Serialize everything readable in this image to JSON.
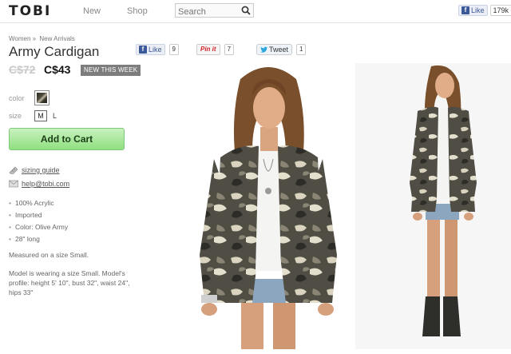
{
  "header": {
    "logo": "TOBI",
    "nav": [
      {
        "label": "New"
      },
      {
        "label": "Shop"
      }
    ],
    "search": {
      "placeholder": "Search",
      "value": ""
    },
    "fb_like": {
      "label": "Like",
      "count": "179k"
    }
  },
  "breadcrumb": {
    "items": [
      "Women",
      "New Arrivals"
    ],
    "separator": "»"
  },
  "product": {
    "title": "Army Cardigan",
    "price_old": "C$72",
    "price_new": "C$43",
    "badge": "NEW THIS WEEK",
    "color_label": "color",
    "size_label": "size",
    "sizes": [
      "M",
      "L"
    ],
    "selected_size": "M",
    "add_to_cart": "Add to Cart",
    "sizing_guide": "sizing guide",
    "help_email": "help@tobi.com",
    "specs": [
      "100% Acrylic",
      "Imported",
      "Color: Olive Army",
      "28\" long"
    ],
    "measured_note": "Measured on a size Small.",
    "model_note": "Model is wearing a size Small. Model's profile: height 5' 10\", bust 32\", waist 24\", hips 33\""
  },
  "share": {
    "fb": {
      "label": "Like",
      "count": "9"
    },
    "pinterest": {
      "label": "Pin it",
      "count": "7"
    },
    "twitter": {
      "label": "Tweet",
      "count": "1"
    }
  },
  "colors": {
    "cart_button": "#8fe07f",
    "facebook": "#3b5998",
    "badge": "#7d7d7d",
    "pinterest": "#cb2027"
  },
  "icons": [
    "search-icon",
    "facebook-icon",
    "twitter-bird-icon",
    "ruler-icon",
    "mail-icon"
  ]
}
